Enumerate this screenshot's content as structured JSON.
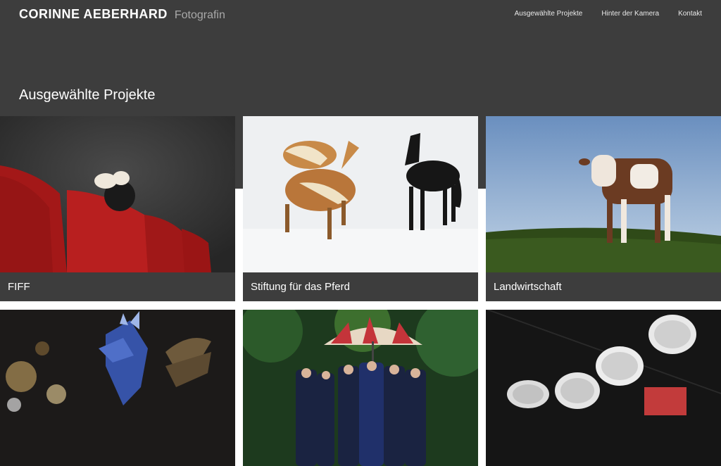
{
  "header": {
    "name": "CORINNE AEBERHARD",
    "subtitle": "Fotografin",
    "nav": [
      "Ausgewählte Projekte",
      "Hinter der Kamera",
      "Kontakt"
    ]
  },
  "section": {
    "title": "Ausgewählte Projekte"
  },
  "projects": [
    {
      "title": "FIFF"
    },
    {
      "title": "Stiftung für das Pferd"
    },
    {
      "title": "Landwirtschaft"
    },
    {
      "title": ""
    },
    {
      "title": ""
    },
    {
      "title": ""
    }
  ],
  "colors": {
    "band": "#3d3d3d",
    "accent": "#ffffff"
  }
}
